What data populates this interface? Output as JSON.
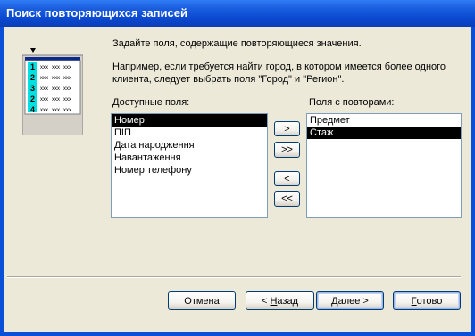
{
  "window": {
    "title": "Поиск повторяющихся записей"
  },
  "instructions": {
    "line1": "Задайте поля, содержащие повторяющиеся значения.",
    "line2a": "Например, если требуется найти город, в котором имеется более одного",
    "line2b": "клиента, следует выбрать поля \"Город\" и \"Регион\"."
  },
  "available": {
    "label": "Доступные поля:",
    "items": [
      "Номер",
      "ПІП",
      "Дата народження",
      "Навантаження",
      "Номер телефону"
    ],
    "selected_index": 0
  },
  "selected_fields": {
    "label": "Поля с повторами:",
    "items": [
      "Предмет",
      "Стаж"
    ],
    "selected_index": 1
  },
  "transfer_buttons": {
    "add_one": ">",
    "add_all": ">>",
    "remove_one": "<",
    "remove_all": "<<"
  },
  "footer": {
    "cancel": "Отмена",
    "back_prefix": "< ",
    "back_key": "Н",
    "back_rest": "азад",
    "next_key": "Д",
    "next_rest": "алее >",
    "finish_key": "Г",
    "finish_rest": "отово"
  },
  "illustration": {
    "row_numbers": [
      "1",
      "2",
      "3",
      "2",
      "4"
    ],
    "cell_text": "xxx"
  },
  "colors": {
    "accent": "#0b4fd8",
    "highlight_column": "#00e0e0"
  }
}
